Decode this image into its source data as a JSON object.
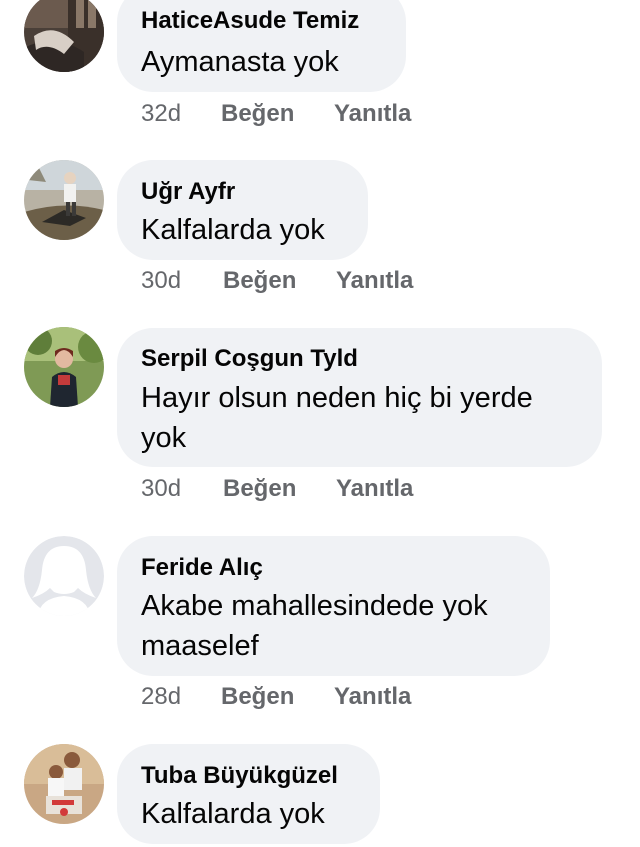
{
  "comments": [
    {
      "author": "HaticeAsude Temiz",
      "text": "Aymanasta yok",
      "age": "32d",
      "like_label": "Beğen",
      "reply_label": "Yanıtla"
    },
    {
      "author": "Uğr Ayfr",
      "text": "Kalfalarda yok",
      "age": "30d",
      "like_label": "Beğen",
      "reply_label": "Yanıtla"
    },
    {
      "author": "Serpil Coşgun Tyld",
      "text": "Hayır olsun neden hiç bi yerde yok",
      "age": "30d",
      "like_label": "Beğen",
      "reply_label": "Yanıtla"
    },
    {
      "author": "Feride Alıç",
      "text": "Akabe mahallesindede yok maaselef",
      "age": "28d",
      "like_label": "Beğen",
      "reply_label": "Yanıtla"
    },
    {
      "author": "Tuba Büyükgüzel",
      "text": "Kalfalarda yok"
    }
  ],
  "colors": {
    "bubble": "#f0f2f5",
    "meta": "#65676b",
    "text": "#050505",
    "default_avatar": "#ccd0d5"
  }
}
